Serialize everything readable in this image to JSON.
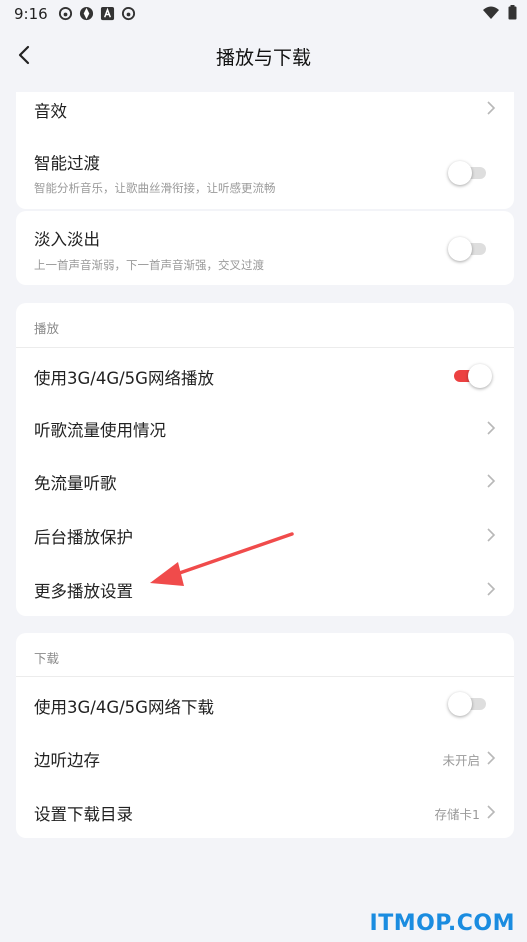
{
  "status_bar": {
    "time": "9:16"
  },
  "header": {
    "title": "播放与下载"
  },
  "top_items": {
    "sound_effect": "音效",
    "smart_transition": {
      "title": "智能过渡",
      "subtitle": "智能分析音乐，让歌曲丝滑衔接，让听感更流畅",
      "enabled": false
    },
    "fade": {
      "title": "淡入淡出",
      "subtitle": "上一首声音渐弱，下一首声音渐强，交叉过渡",
      "enabled": false
    }
  },
  "playback": {
    "section_label": "播放",
    "items": [
      {
        "label": "使用3G/4G/5G网络播放",
        "enabled": true
      },
      {
        "label": "听歌流量使用情况"
      },
      {
        "label": "免流量听歌"
      },
      {
        "label": "后台播放保护"
      },
      {
        "label": "更多播放设置"
      }
    ]
  },
  "download": {
    "section_label": "下载",
    "items": [
      {
        "label": "使用3G/4G/5G网络下载",
        "enabled": false
      },
      {
        "label": "边听边存",
        "value": "未开启"
      },
      {
        "label": "设置下载目录",
        "value": "存储卡1"
      }
    ]
  },
  "colors": {
    "accent": "#ec4141",
    "background": "#f3f4f8",
    "watermark": "#1a8ce0"
  },
  "watermark": "ITMOP.COM"
}
